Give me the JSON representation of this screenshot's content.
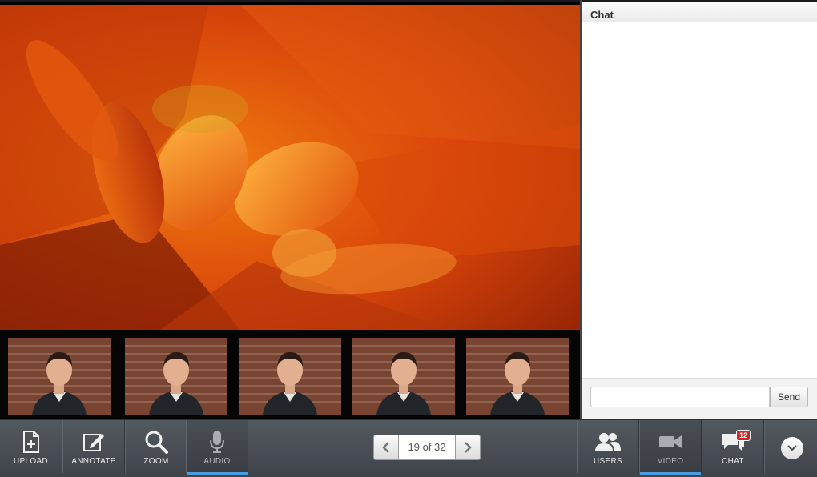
{
  "chat": {
    "title": "Chat",
    "input_value": "",
    "input_placeholder": "",
    "send_label": "Send"
  },
  "toolbar": {
    "upload_label": "UPLOAD",
    "annotate_label": "ANNOTATE",
    "zoom_label": "ZOOM",
    "audio_label": "AUDIO",
    "users_label": "USERS",
    "video_label": "VIDEO",
    "chat_label": "CHAT",
    "chat_badge": "12",
    "icons": {
      "upload": "upload-icon",
      "annotate": "annotate-icon",
      "zoom": "zoom-icon",
      "audio": "microphone-icon",
      "users": "users-icon",
      "video": "video-camera-icon",
      "chat": "chat-bubbles-icon",
      "menu": "chevron-down-icon"
    }
  },
  "pager": {
    "text": "19 of 32"
  },
  "colors": {
    "accent": "#4a9de0",
    "badge": "#c82a2a",
    "toolbar": "#4a4e55"
  },
  "thumbnails": [
    "participant-video",
    "participant-video",
    "participant-video",
    "participant-video",
    "participant-video"
  ]
}
